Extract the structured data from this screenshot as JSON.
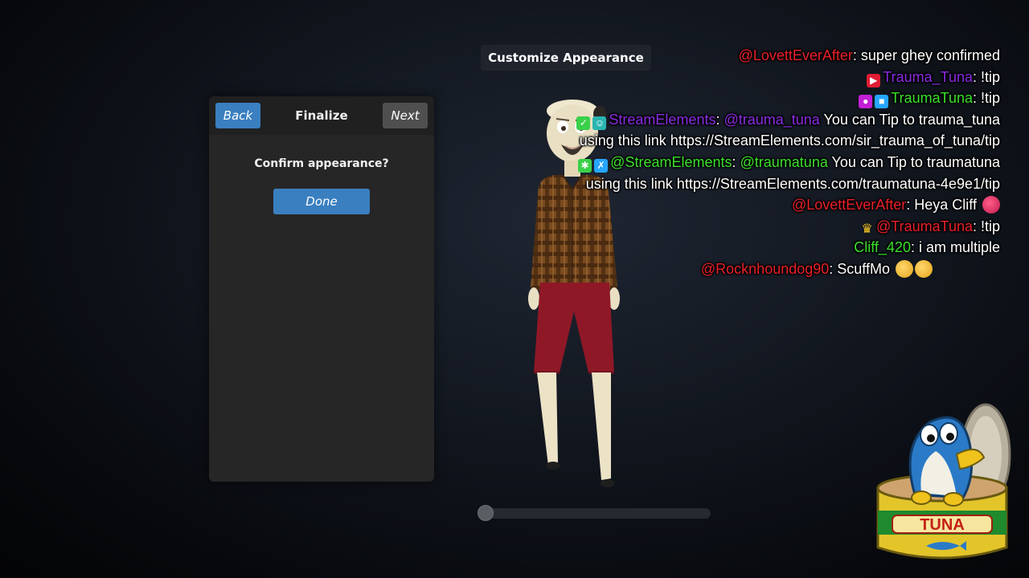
{
  "panel": {
    "back_label": "Back",
    "title": "Finalize",
    "next_label": "Next",
    "confirm_text": "Confirm appearance?",
    "done_label": "Done"
  },
  "customize_title": "Customize Appearance",
  "slider": {
    "value": 0
  },
  "chat": {
    "messages": [
      {
        "user": "@LovettEverAfter",
        "text": ": super ghey confirmed"
      },
      {
        "badges": [
          "video-badge-icon"
        ],
        "user": "Trauma_Tuna",
        "text": ": !tip"
      },
      {
        "badges": [
          "mic-badge-icon",
          "cube-badge-icon"
        ],
        "user": "TraumaTuna",
        "text": ": !tip"
      },
      {
        "badges": [
          "sword-badge-icon",
          "bot-badge-icon"
        ],
        "user": "StreamElements",
        "text": ": ",
        "mention": "@trauma_tuna",
        "after": " You can Tip to trauma_tuna using this link https://StreamElements.com/sir_trauma_of_tuna/tip"
      },
      {
        "badges": [
          "gear-badge-icon",
          "sword-badge-icon"
        ],
        "user": "@StreamElements",
        "text": ": ",
        "mention": "@traumatuna",
        "after": " You can Tip to traumatuna using this link https://StreamElements.com/traumatuna-4e9e1/tip"
      },
      {
        "user": "@LovettEverAfter",
        "text": ": Heya Cliff"
      },
      {
        "badges": [
          "crown-badge-icon"
        ],
        "user": "@TraumaTuna",
        "text": ": !tip"
      },
      {
        "user": "Cliff_420",
        "text": ": i am multiple"
      },
      {
        "user": "@Rocknhoundog90",
        "text": ": ScuffMo"
      }
    ]
  },
  "logo": {
    "label": "TUNA"
  },
  "colors": {
    "accent_blue": "#3a7fc0",
    "chat_red": "#e8202a",
    "chat_purple": "#8a2be2",
    "chat_green": "#3ce02c"
  }
}
